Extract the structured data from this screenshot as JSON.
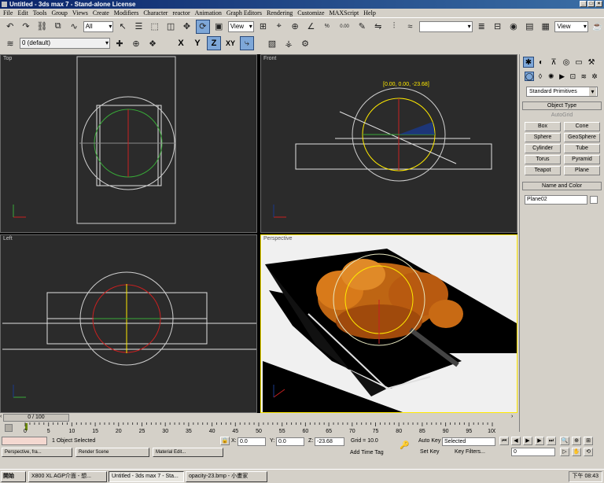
{
  "window": {
    "title": "Untitled - 3ds max 7 - Stand-alone License"
  },
  "menu": [
    "File",
    "Edit",
    "Tools",
    "Group",
    "Views",
    "Create",
    "Modifiers",
    "Character",
    "reactor",
    "Animation",
    "Graph Editors",
    "Rendering",
    "Customize",
    "MAXScript",
    "Help"
  ],
  "toolbar": {
    "selection_filter": "All",
    "ref_coord": "View",
    "named_selection": "",
    "render_view": "View",
    "spinner_snap": "0.00"
  },
  "layer_toolbar": {
    "layer": "0 (default)"
  },
  "axes": [
    "X",
    "Y",
    "Z",
    "XY"
  ],
  "viewports": {
    "top": {
      "label": "Top"
    },
    "front": {
      "label": "Front",
      "gizmo_readout": "[0.00, 0.00, -23.68]"
    },
    "left": {
      "label": "Left"
    },
    "perspective": {
      "label": "Perspective"
    }
  },
  "command_panel": {
    "category": "Standard Primitives",
    "object_type_header": "Object Type",
    "autogrid": "AutoGrid",
    "objects": [
      "Box",
      "Cone",
      "Sphere",
      "GeoSphere",
      "Cylinder",
      "Tube",
      "Torus",
      "Pyramid",
      "Teapot",
      "Plane"
    ],
    "name_color_header": "Name and Color",
    "object_name": "Plane02"
  },
  "timeline": {
    "frame": "0 / 100",
    "ticks": [
      "0",
      "5",
      "10",
      "15",
      "20",
      "25",
      "30",
      "35",
      "40",
      "45",
      "50",
      "55",
      "60",
      "65",
      "70",
      "75",
      "80",
      "85",
      "90",
      "95",
      "100"
    ]
  },
  "status": {
    "selection": "1 Object Selected",
    "x_label": "X:",
    "x_value": "0.0",
    "y_label": "Y:",
    "y_value": "0.0",
    "z_label": "Z:",
    "z_value": "-23.68",
    "grid": "Grid = 10.0",
    "add_time_tag": "Add Time Tag",
    "auto_key": "Auto Key",
    "set_key": "Set Key",
    "key_mode": "Selected",
    "key_filters": "Key Filters...",
    "current_frame": "0"
  },
  "minitasks": [
    "Perspective, fra...",
    "Render Scene",
    "Material Edit..."
  ],
  "taskbar": {
    "start": "開始",
    "items": [
      "X800 XL AGP介面 - 想...",
      "Untitled - 3ds max 7 - Sta...",
      "opacity-23.bmp - 小畫家"
    ],
    "clock": "下午 08:43"
  }
}
